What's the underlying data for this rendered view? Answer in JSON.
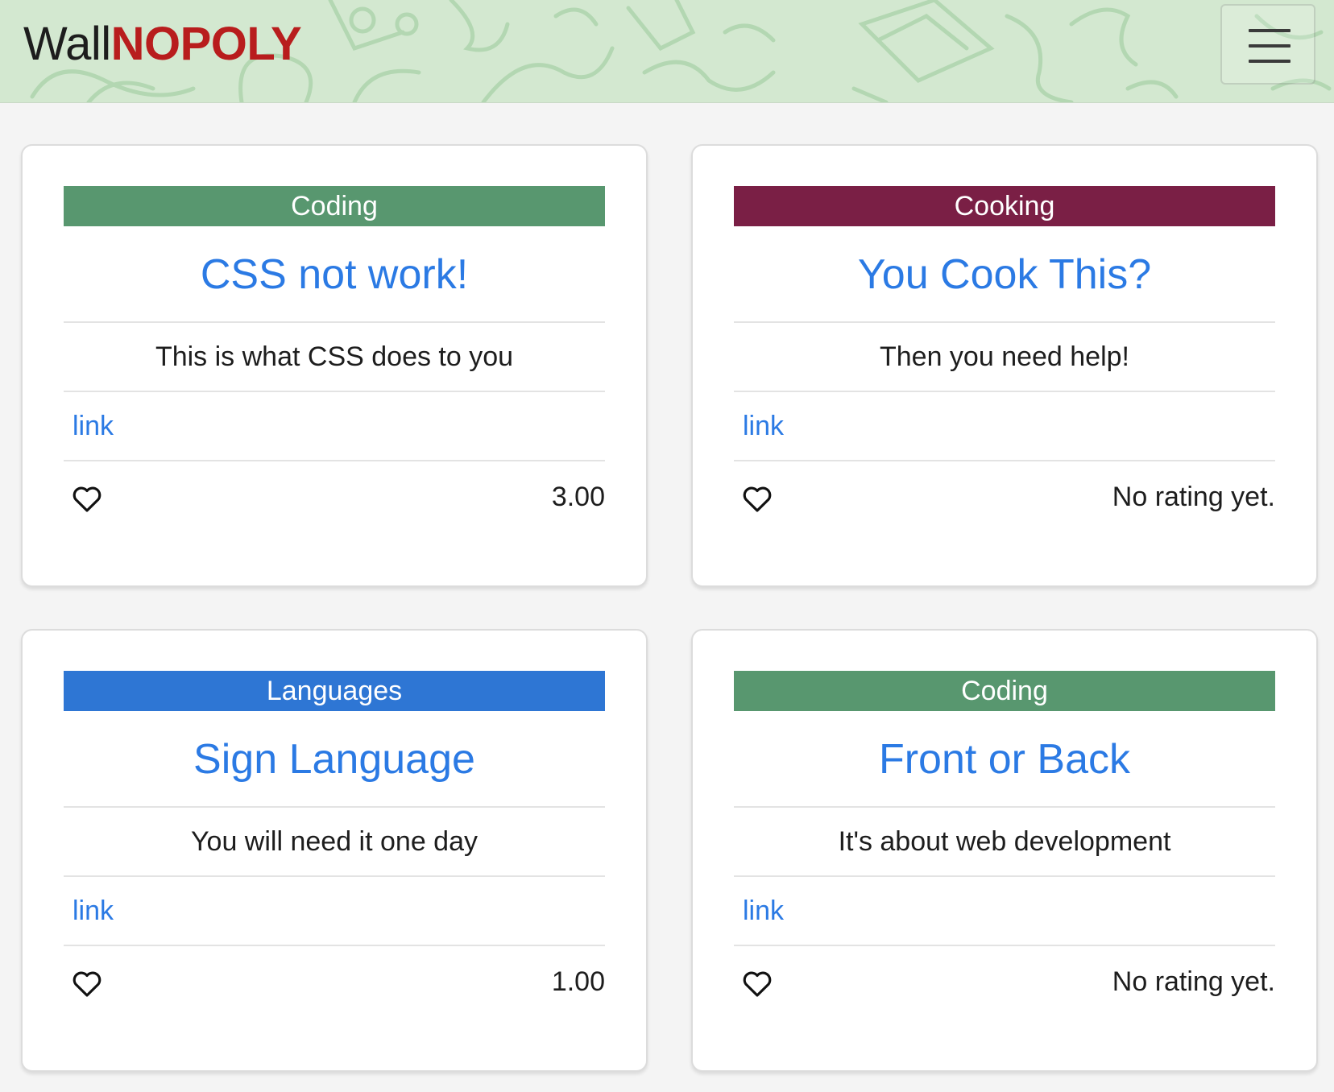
{
  "navbar": {
    "brand_prefix": "Wall",
    "brand_suffix": "NOPOLY",
    "brand_prefix_color": "#1d1d1d",
    "brand_suffix_color": "#b81d1d",
    "background_color": "#d3e8d0",
    "menu_icon": "hamburger-menu-icon"
  },
  "cards": [
    {
      "category": "Coding",
      "category_color": "#58976f",
      "title": "CSS not work!",
      "description": "This is what CSS does to you",
      "link_label": "link",
      "like_icon": "heart-outline-icon",
      "rating": "3.00"
    },
    {
      "category": "Cooking",
      "category_color": "#7a1f45",
      "title": "You Cook This?",
      "description": "Then you need help!",
      "link_label": "link",
      "like_icon": "heart-outline-icon",
      "rating": "No rating yet."
    },
    {
      "category": "Languages",
      "category_color": "#2e76d4",
      "title": "Sign Language",
      "description": "You will need it one day",
      "link_label": "link",
      "like_icon": "heart-outline-icon",
      "rating": "1.00"
    },
    {
      "category": "Coding",
      "category_color": "#58976f",
      "title": "Front or Back",
      "description": "It's about web development",
      "link_label": "link",
      "like_icon": "heart-outline-icon",
      "rating": "No rating yet."
    }
  ],
  "colors": {
    "accent_link": "#2b7ae4",
    "page_background": "#f4f4f4"
  }
}
